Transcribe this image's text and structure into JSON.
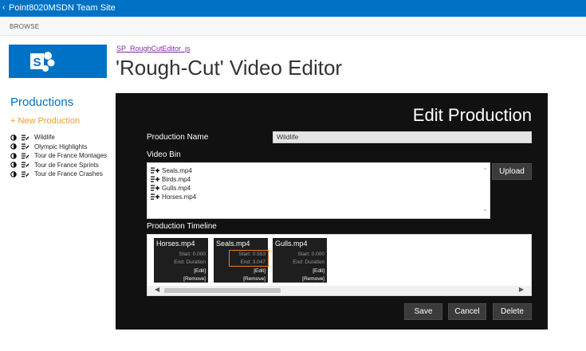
{
  "suite_bar": {
    "back_icon": "chevron-left-icon",
    "site_name": "Point8020MSDN Team Site",
    "color": "#0072c6"
  },
  "ribbon": {
    "browse_tab": "BROWSE"
  },
  "header": {
    "page_link": "SP_RoughCutEditor_js",
    "title": "'Rough-Cut' Video Editor"
  },
  "nav": {
    "heading": "Productions",
    "new_production": "+ New Production",
    "items": [
      {
        "label": "Wildlife"
      },
      {
        "label": "Olympic Highlights"
      },
      {
        "label": "Tour de France Montages"
      },
      {
        "label": "Tour de France Sprints"
      },
      {
        "label": "Tour de France Crashes"
      }
    ]
  },
  "editor": {
    "title": "Edit Production",
    "production_name_label": "Production Name",
    "production_name_value": "Wildlife",
    "video_bin_label": "Video Bin",
    "video_bin": [
      {
        "file": "Seals.mp4"
      },
      {
        "file": "Birds.mp4"
      },
      {
        "file": "Gulls.mp4"
      },
      {
        "file": "Horses.mp4"
      }
    ],
    "upload_label": "Upload",
    "timeline_label": "Production Timeline",
    "clips": [
      {
        "name": "Horses.mp4",
        "start": "Start: 0.000",
        "end": "End: Duration",
        "edit": "[Edit]",
        "remove": "[Remove]"
      },
      {
        "name": "Seals.mp4",
        "start": "Start: 0.553",
        "end": "End: 3.047",
        "edit": "[Edit]",
        "remove": "[Remove]"
      },
      {
        "name": "Gulls.mp4",
        "start": "Start: 0.000",
        "end": "End: Duration",
        "edit": "[Edit]",
        "remove": "[Remove]"
      }
    ],
    "save_label": "Save",
    "cancel_label": "Cancel",
    "delete_label": "Delete",
    "highlight_color": "#f07c1c"
  }
}
